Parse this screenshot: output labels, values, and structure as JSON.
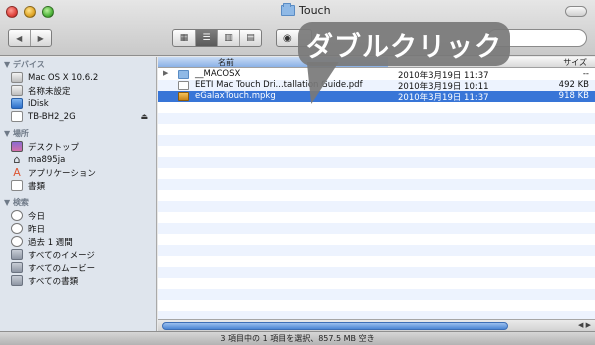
{
  "window": {
    "title": "Touch"
  },
  "callout": {
    "text": "ダブルクリック"
  },
  "sidebar": {
    "devices_header": "▼ デバイス",
    "devices": [
      {
        "label": "Mac OS X 10.6.2",
        "icon": "hard-disk-icon"
      },
      {
        "label": "名称未設定",
        "icon": "hard-disk-icon"
      },
      {
        "label": "iDisk",
        "icon": "idisk-icon"
      },
      {
        "label": "TB-BH2_2G",
        "icon": "drive-icon",
        "eject": "⏏"
      }
    ],
    "places_header": "▼ 場所",
    "places": [
      {
        "label": "デスクトップ",
        "icon": "desktop-icon"
      },
      {
        "label": "ma895ja",
        "icon": "home-icon"
      },
      {
        "label": "アプリケーション",
        "icon": "applications-icon"
      },
      {
        "label": "書類",
        "icon": "documents-icon"
      }
    ],
    "search_header": "▼ 検索",
    "searches": [
      {
        "label": "今日",
        "icon": "clock-icon"
      },
      {
        "label": "昨日",
        "icon": "clock-icon"
      },
      {
        "label": "過去 1 週間",
        "icon": "clock-icon"
      },
      {
        "label": "すべてのイメージ",
        "icon": "smart-folder-icon"
      },
      {
        "label": "すべてのムービー",
        "icon": "smart-folder-icon"
      },
      {
        "label": "すべての書類",
        "icon": "smart-folder-icon"
      }
    ]
  },
  "list": {
    "columns": {
      "name": "名前",
      "size": "サイズ"
    },
    "rows": [
      {
        "triangle": "▶",
        "icon": "folder-icon",
        "name": "__MACOSX",
        "date": "2010年3月19日 11:37",
        "size": "--",
        "selected": false
      },
      {
        "triangle": "",
        "icon": "pdf-icon",
        "name": "EETI Mac Touch Dri...tallation Guide.pdf",
        "date": "2010年3月19日 10:11",
        "size": "492 KB",
        "selected": false
      },
      {
        "triangle": "",
        "icon": "package-icon",
        "name": "eGalaxTouch.mpkg",
        "date": "2010年3月19日 11:37",
        "size": "918 KB",
        "selected": true
      }
    ]
  },
  "status": {
    "text": "3 項目中の 1 項目を選択、857.5 MB 空き"
  },
  "colors": {
    "selection": "#3875d7",
    "sidebar": "#dfe5ed",
    "stripe": "#edf3fe"
  }
}
